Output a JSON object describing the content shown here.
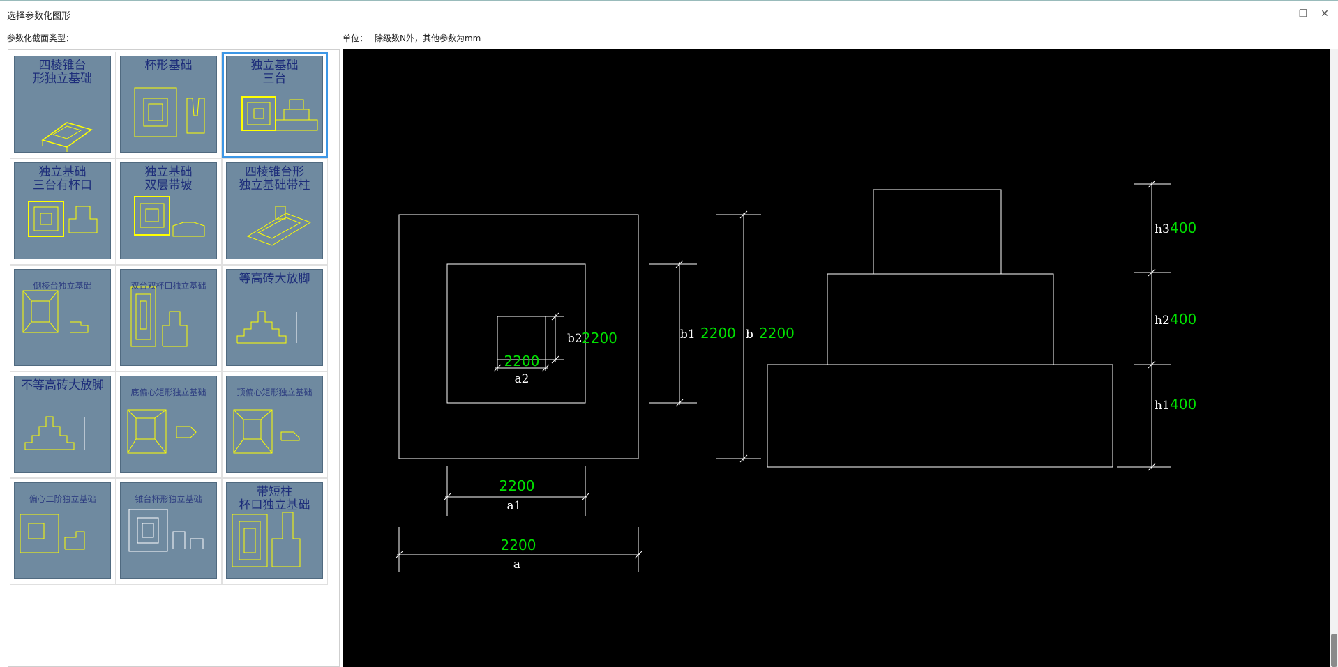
{
  "window": {
    "title": "选择参数化图形",
    "restore_icon": "restore-icon",
    "close_icon": "close-icon"
  },
  "left_label": "参数化截面类型：",
  "unit": {
    "label": "单位：",
    "value": "除级数N外，其他参数为mm"
  },
  "thumbnails": [
    {
      "title": "四棱锥台\n形独立基础",
      "selected": false
    },
    {
      "title": "杯形基础",
      "selected": false
    },
    {
      "title": "独立基础\n三台",
      "selected": true
    },
    {
      "title": "独立基础\n三台有杯口",
      "selected": false
    },
    {
      "title": "独立基础\n双层带坡",
      "selected": false
    },
    {
      "title": "四棱锥台形\n独立基础带柱",
      "selected": false
    },
    {
      "title": "倒棱台独立基础",
      "selected": false
    },
    {
      "title": "双台双杯口独立基础",
      "selected": false
    },
    {
      "title": "等高砖大放脚",
      "selected": false
    },
    {
      "title": "不等高砖大放脚",
      "selected": false
    },
    {
      "title": "底偏心矩形独立基础",
      "selected": false
    },
    {
      "title": "顶偏心矩形独立基础",
      "selected": false
    },
    {
      "title": "偏心二阶独立基础",
      "selected": false
    },
    {
      "title": "锥台杯形独立基础",
      "selected": false
    },
    {
      "title": "带短柱\n杯口独立基础",
      "selected": false
    }
  ],
  "drawing": {
    "colors": {
      "background": "#000000",
      "lines": "#ffffff",
      "values": "#00e000"
    },
    "plan": {
      "a": {
        "label": "a",
        "value": "2200"
      },
      "a1": {
        "label": "a1",
        "value": "2200"
      },
      "a2": {
        "label": "a2",
        "value": "2200"
      },
      "b": {
        "label": "b",
        "value": "2200"
      },
      "b1": {
        "label": "b1",
        "value": "2200"
      },
      "b2": {
        "label": "b2",
        "value": "2200"
      }
    },
    "elevation": {
      "h1": {
        "label": "h1",
        "value": "400"
      },
      "h2": {
        "label": "h2",
        "value": "400"
      },
      "h3": {
        "label": "h3",
        "value": "400"
      }
    }
  }
}
